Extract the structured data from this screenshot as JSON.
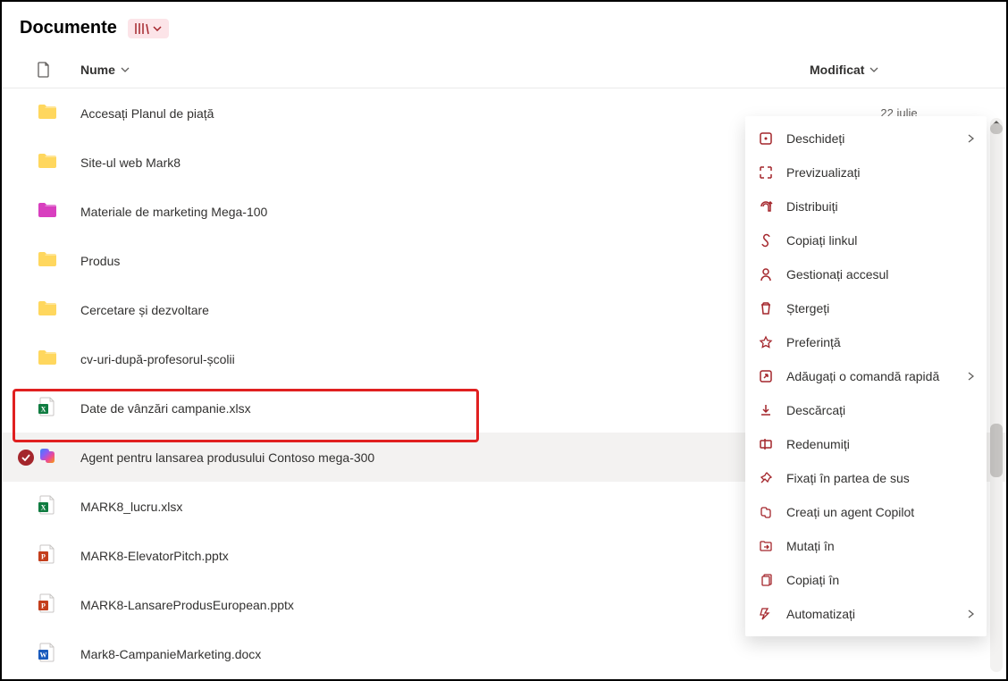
{
  "header": {
    "title": "Documente"
  },
  "columns": {
    "name": "Nume",
    "modified": "Modificat"
  },
  "rows": [
    {
      "type": "folder",
      "color": "#ffd75e",
      "name": "Accesați Planul de piață",
      "modified": "22 iulie"
    },
    {
      "type": "folder",
      "color": "#ffd75e",
      "name": "Site-ul web Mark8",
      "modified": ""
    },
    {
      "type": "folder",
      "color": "#d83fbf",
      "name": "Materiale de marketing Mega-100",
      "modified": ""
    },
    {
      "type": "folder",
      "color": "#ffd75e",
      "name": "Produs",
      "modified": ""
    },
    {
      "type": "folder",
      "color": "#ffd75e",
      "name": "Cercetare și dezvoltare",
      "modified": ""
    },
    {
      "type": "folder",
      "color": "#ffd75e",
      "name": "cv-uri-după-profesorul-școlii",
      "modified": ""
    },
    {
      "type": "xlsx",
      "name": "Date de vânzări campanie.xlsx",
      "modified": ""
    },
    {
      "type": "copilot",
      "name": "Agent pentru lansarea produsului Contoso mega-300",
      "modified": "",
      "selected": true
    },
    {
      "type": "xlsx",
      "name": "MARK8_lucru.xlsx",
      "modified": ""
    },
    {
      "type": "pptx",
      "name": "MARK8-ElevatorPitch.pptx",
      "modified": ""
    },
    {
      "type": "pptx",
      "name": "MARK8-LansareProdusEuropean.pptx",
      "modified": ""
    },
    {
      "type": "docx",
      "name": "Mark8-CampanieMarketing.docx",
      "modified": ""
    }
  ],
  "contextMenu": [
    {
      "icon": "open",
      "label": "Deschideți",
      "submenu": true
    },
    {
      "icon": "preview",
      "label": "Previzualizați"
    },
    {
      "icon": "share",
      "label": "Distribuiți"
    },
    {
      "icon": "link",
      "label": "Copiați linkul"
    },
    {
      "icon": "access",
      "label": "Gestionați accesul"
    },
    {
      "icon": "delete",
      "label": "Ștergeți"
    },
    {
      "icon": "favorite",
      "label": "Preferință"
    },
    {
      "icon": "shortcut",
      "label": "Adăugați o comandă rapidă",
      "submenu": true
    },
    {
      "icon": "download",
      "label": "Descărcați",
      "highlighted": true
    },
    {
      "icon": "rename",
      "label": "Redenumiți"
    },
    {
      "icon": "pin",
      "label": "Fixați în partea de sus"
    },
    {
      "icon": "copilot-create",
      "label": "Creați un agent Copilot"
    },
    {
      "icon": "move",
      "label": "Mutați în"
    },
    {
      "icon": "copy",
      "label": "Copiați în"
    },
    {
      "icon": "automate",
      "label": "Automatizați",
      "submenu": true
    }
  ],
  "colors": {
    "accent": "#a4262c"
  }
}
